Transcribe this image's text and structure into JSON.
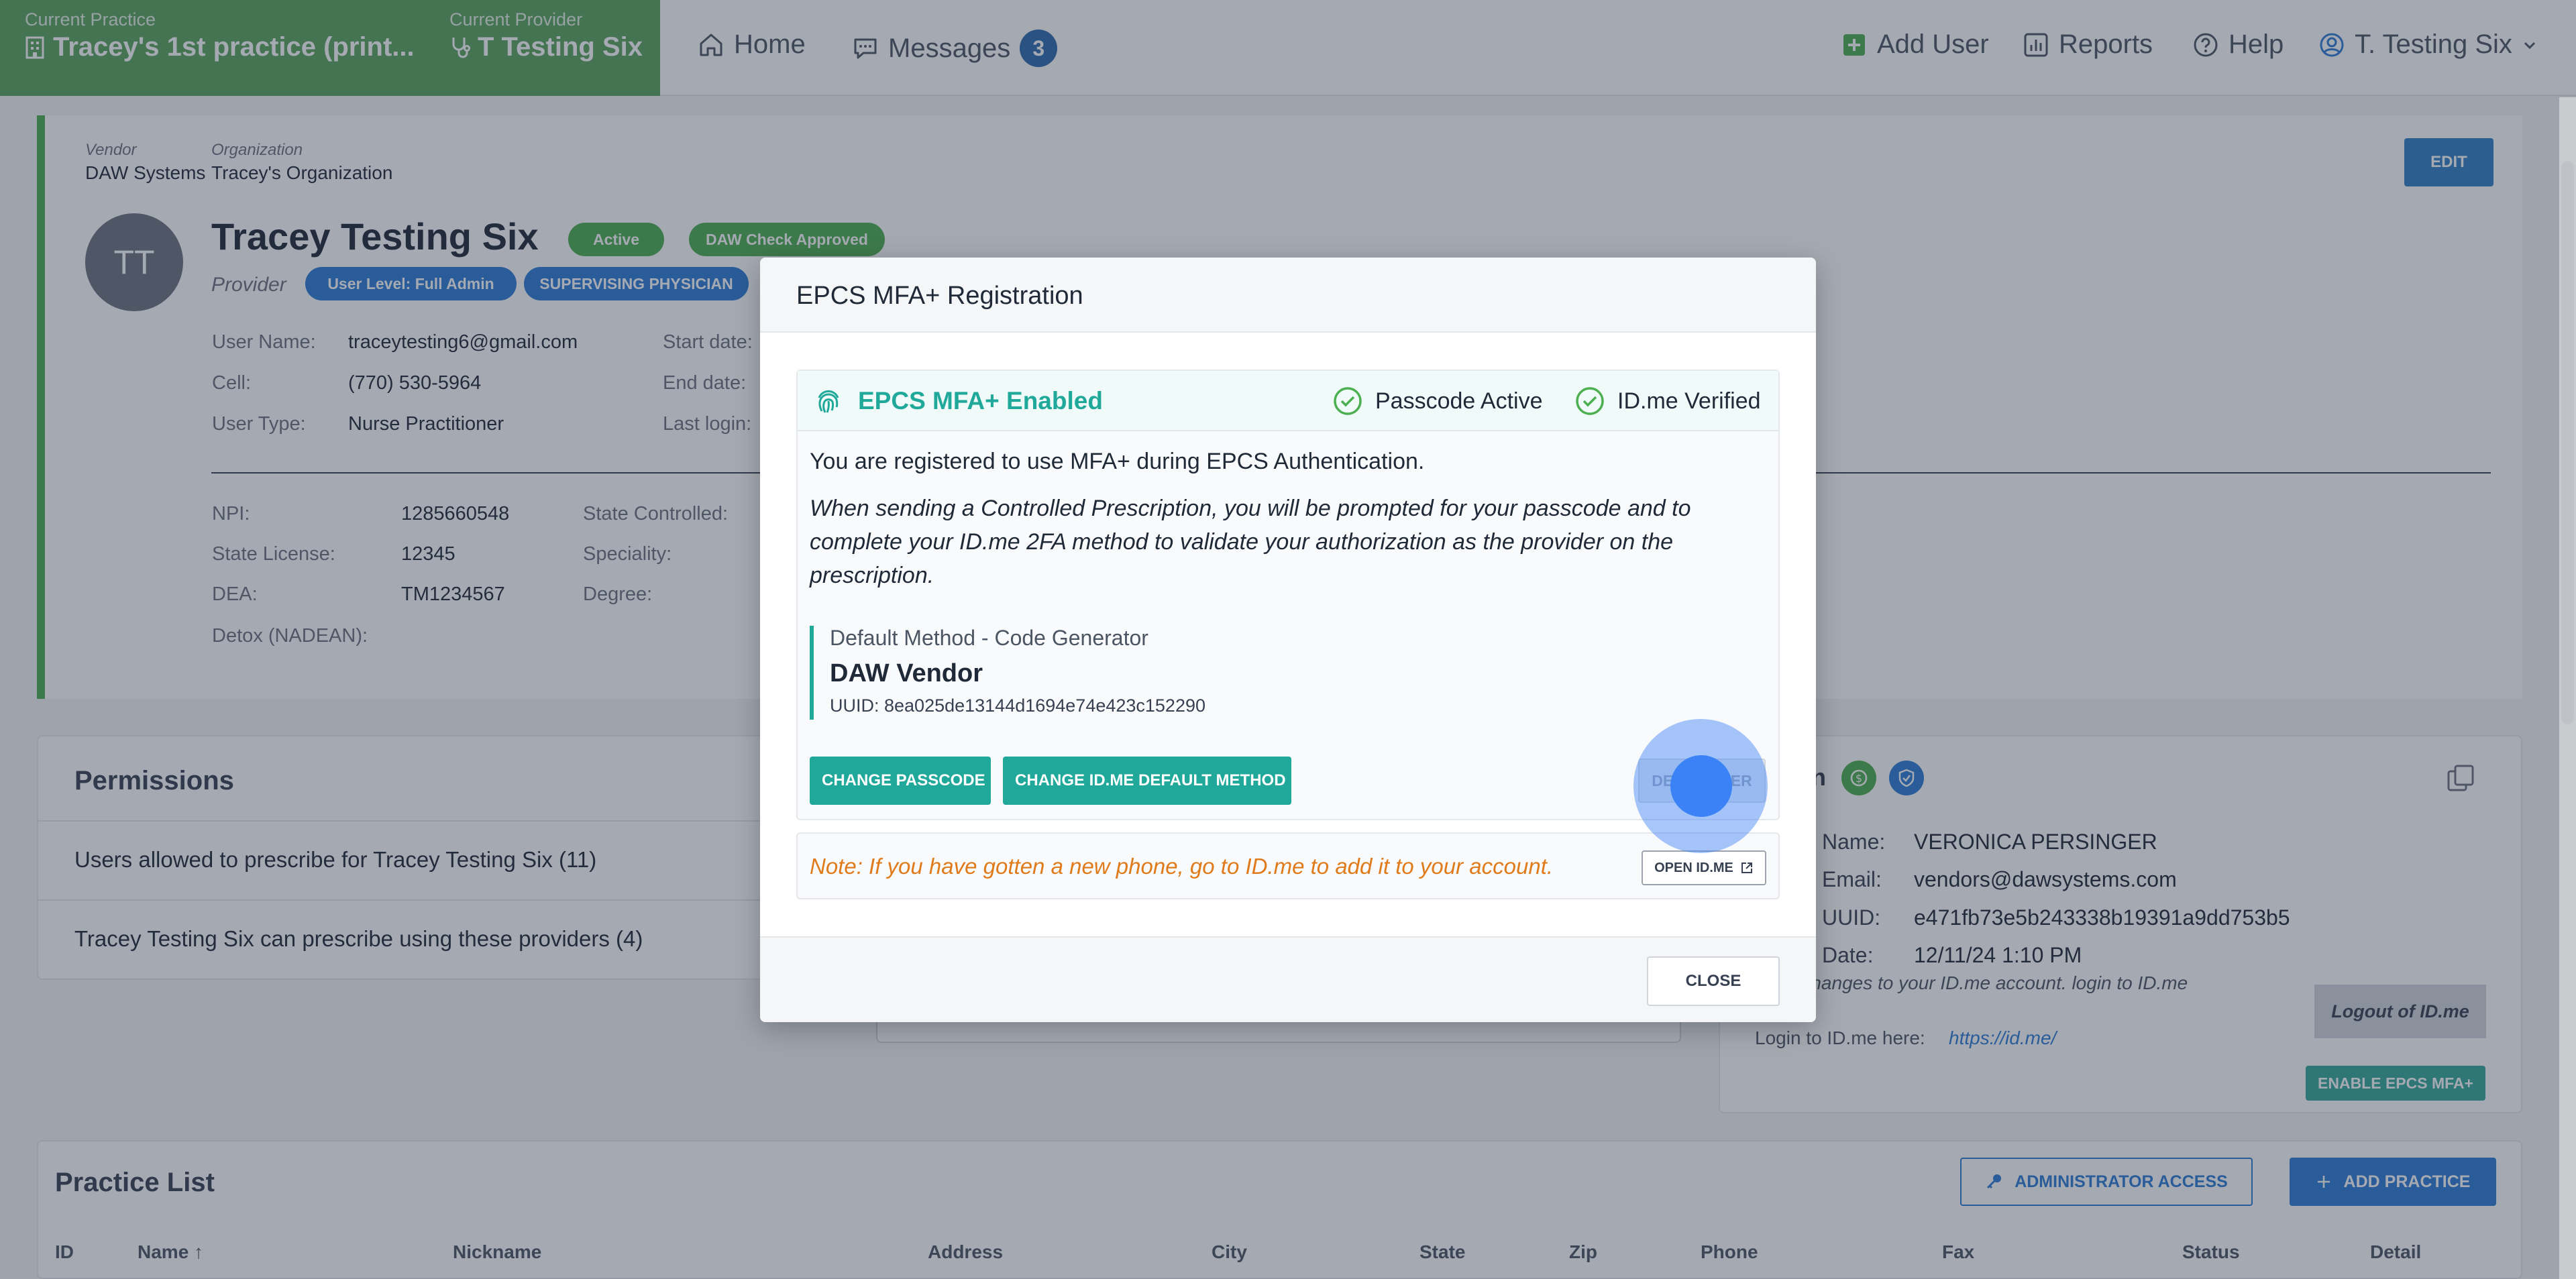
{
  "topnav": {
    "practice_label": "Current Practice",
    "practice_value": "Tracey's 1st practice (print...",
    "provider_label": "Current Provider",
    "provider_value": "T Testing Six",
    "home": "Home",
    "messages": "Messages",
    "messages_count": "3",
    "add_user": "Add User",
    "reports": "Reports",
    "help": "Help",
    "user_menu": "T. Testing Six"
  },
  "profile": {
    "vendor_label": "Vendor",
    "vendor_value": "DAW Systems",
    "org_label": "Organization",
    "org_value": "Tracey's Organization",
    "edit": "EDIT",
    "initials": "TT",
    "name": "Tracey Testing Six",
    "status_active": "Active",
    "status_daw": "DAW Check Approved",
    "role": "Provider",
    "user_level": "User Level: Full Admin",
    "supervising": "SUPERVISING PHYSICIAN",
    "fields": {
      "username_label": "User Name:",
      "username_value": "traceytesting6@gmail.com",
      "cell_label": "Cell:",
      "cell_value": "(770) 530-5964",
      "usertype_label": "User Type:",
      "usertype_value": "Nurse Practitioner",
      "start_label": "Start date:",
      "end_label": "End date:",
      "lastlogin_label": "Last login:",
      "npi_label": "NPI:",
      "npi_value": "1285660548",
      "license_label": "State License:",
      "license_value": "12345",
      "dea_label": "DEA:",
      "dea_value": "TM1234567",
      "detox_label": "Detox (NADEAN):",
      "statecontrolled_label": "State Controlled:",
      "speciality_label": "Speciality:",
      "degree_label": "Degree:"
    }
  },
  "permissions": {
    "title": "Permissions",
    "row1": "Users allowed to prescribe for Tracey Testing Six (11)",
    "row2": "Tracey Testing Six can prescribe using these providers (4)"
  },
  "idme_card": {
    "title_suffix": "n",
    "name_label": "Name:",
    "name_value": "VERONICA PERSINGER",
    "email_label": "Email:",
    "email_value": "vendors@dawsystems.com",
    "uuid_label": "UUID:",
    "uuid_value": "e471fb73e5b243338b19391a9dd753b5",
    "date_label": "Date:",
    "date_value": "12/11/24 1:10 PM",
    "changes_text": "ke changes to your ID.me account. login to ID.me",
    "login_text": "Login to ID.me here:",
    "login_link": "https://id.me/",
    "logout": "Logout of ID.me",
    "enable": "ENABLE EPCS MFA+"
  },
  "practice_list": {
    "title": "Practice List",
    "admin_access": "ADMINISTRATOR ACCESS",
    "add_practice": "ADD PRACTICE",
    "columns": [
      "ID",
      "Name ↑",
      "Nickname",
      "Address",
      "City",
      "State",
      "Zip",
      "Phone",
      "Fax",
      "Status",
      "Detail"
    ]
  },
  "modal": {
    "title": "EPCS MFA+ Registration",
    "enabled": "EPCS MFA+ Enabled",
    "passcode_active": "Passcode Active",
    "idme_verified": "ID.me Verified",
    "registered_text": "You are registered to use MFA+ during EPCS Authentication.",
    "prompt_text": "When sending a Controlled Prescription, you will be prompted for your passcode and to complete your ID.me 2FA method to validate your authorization as the provider on the prescription.",
    "method_head": "Default Method - Code Generator",
    "method_name": "DAW Vendor",
    "method_uuid": "UUID: 8ea025de13144d1694e74e423c152290",
    "change_passcode": "CHANGE PASSCODE",
    "change_method": "CHANGE ID.ME DEFAULT METHOD",
    "deregister": "DEREGISTER",
    "note": "Note: If you have gotten a new phone, go to ID.me to add it to your account.",
    "open_idme": "OPEN ID.ME",
    "close": "CLOSE"
  },
  "colors": {
    "practice_green": "#5aa45c",
    "teal": "#20a99a",
    "primary_blue": "#2b7bd6",
    "note_orange": "#e07b1c"
  }
}
